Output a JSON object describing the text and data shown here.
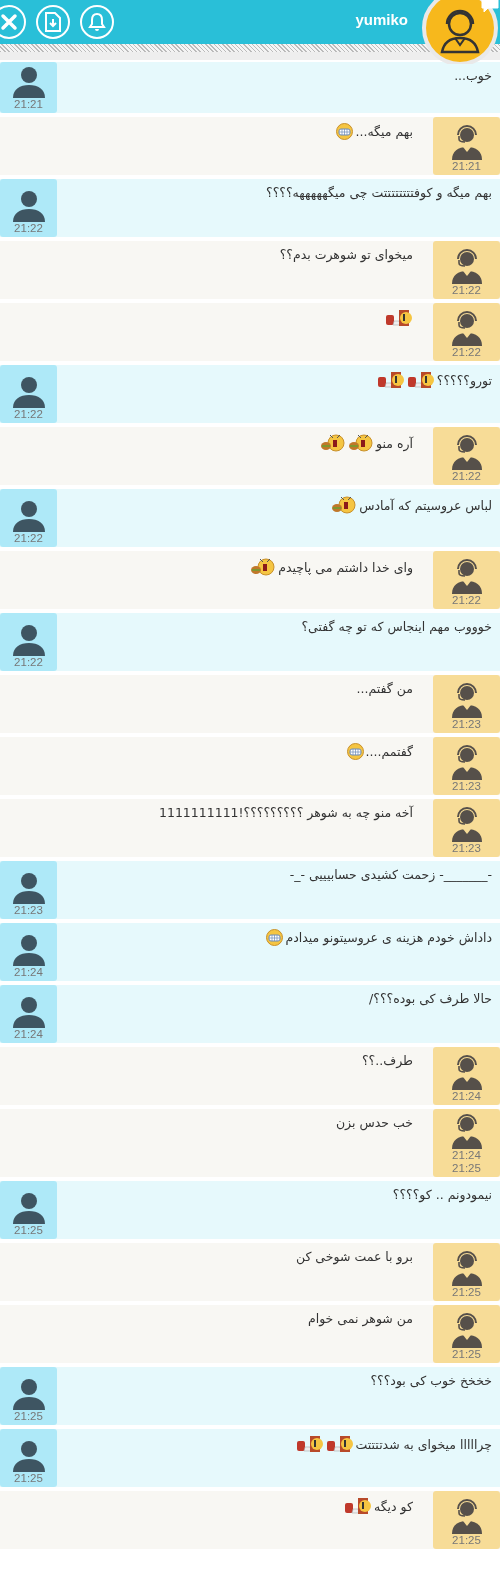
{
  "header": {
    "name": "yumiko"
  },
  "messages": [
    {
      "kind": "user",
      "text": "خوب...",
      "times": [
        "21:21"
      ]
    },
    {
      "kind": "agent",
      "text": "بهم میگه...",
      "emojis": [
        {
          "kind": "grin"
        }
      ],
      "times": [
        "21:21"
      ]
    },
    {
      "kind": "user",
      "text": "بهم میگه و کوفتتتتتتتتت چی میگهههههه؟؟؟؟",
      "times": [
        "21:22"
      ]
    },
    {
      "kind": "agent",
      "text": "میخوای تو شوهرت بدم؟؟",
      "times": [
        "21:22"
      ]
    },
    {
      "kind": "agent",
      "emojis": [
        {
          "kind": "door"
        }
      ],
      "times": [
        "21:22"
      ]
    },
    {
      "kind": "user",
      "text": "تورو؟؟؟؟؟",
      "emojis": [
        {
          "kind": "door"
        },
        {
          "kind": "door"
        }
      ],
      "times": [
        "21:22"
      ]
    },
    {
      "kind": "agent",
      "text": "آره منو",
      "emojis": [
        {
          "kind": "scream"
        },
        {
          "kind": "scream"
        }
      ],
      "times": [
        "21:22"
      ]
    },
    {
      "kind": "user",
      "text": "لباس عروسیتم که آمادس",
      "emojis": [
        {
          "kind": "scream"
        }
      ],
      "times": [
        "21:22"
      ]
    },
    {
      "kind": "agent",
      "text": "وای خدا داشتم می پاچیدم",
      "emojis": [
        {
          "kind": "scream"
        }
      ],
      "times": [
        "21:22"
      ]
    },
    {
      "kind": "user",
      "text": "خوووب مهم اینجاس که تو چه گفتی؟",
      "times": [
        "21:22"
      ]
    },
    {
      "kind": "agent",
      "text": "من گفتم...",
      "times": [
        "21:23"
      ]
    },
    {
      "kind": "agent",
      "text": "گفتمم....",
      "emojis": [
        {
          "kind": "grin"
        }
      ],
      "times": [
        "21:23"
      ]
    },
    {
      "kind": "agent",
      "text": "آخه منو چه به شوهر ؟؟؟؟؟؟؟؟؟!1111111111",
      "times": [
        "21:23"
      ]
    },
    {
      "kind": "user",
      "text": "-_______- زحمت کشیدی حسابیییی -_-",
      "times": [
        "21:23"
      ]
    },
    {
      "kind": "user",
      "text": "داداش خودم هزینه ی عروسیتونو میدادم",
      "emojis": [
        {
          "kind": "grin"
        }
      ],
      "times": [
        "21:24"
      ]
    },
    {
      "kind": "user",
      "text": "حالا طرف کی بوده؟؟؟/",
      "times": [
        "21:24"
      ]
    },
    {
      "kind": "agent",
      "text": "طرف..؟؟",
      "times": [
        "21:24"
      ]
    },
    {
      "kind": "agent",
      "text": "خب حدس بزن",
      "times": [
        "21:24",
        "21:25"
      ]
    },
    {
      "kind": "user",
      "text": "نیمودونم .. کو؟؟؟؟",
      "times": [
        "21:25"
      ]
    },
    {
      "kind": "agent",
      "text": "برو با عمت شوخی کن",
      "times": [
        "21:25"
      ]
    },
    {
      "kind": "agent",
      "text": "من شوهر نمی خوام",
      "times": [
        "21:25"
      ]
    },
    {
      "kind": "user",
      "text": "خخخخ خوب کی بود؟؟؟",
      "times": [
        "21:25"
      ]
    },
    {
      "kind": "user",
      "text": "چرااااا میخوای به شدتتتتت",
      "emojis": [
        {
          "kind": "door"
        },
        {
          "kind": "door"
        }
      ],
      "times": [
        "21:25"
      ]
    },
    {
      "kind": "agent",
      "text": "کو دیگه",
      "emojis": [
        {
          "kind": "door"
        }
      ],
      "times": [
        "21:25"
      ]
    }
  ]
}
